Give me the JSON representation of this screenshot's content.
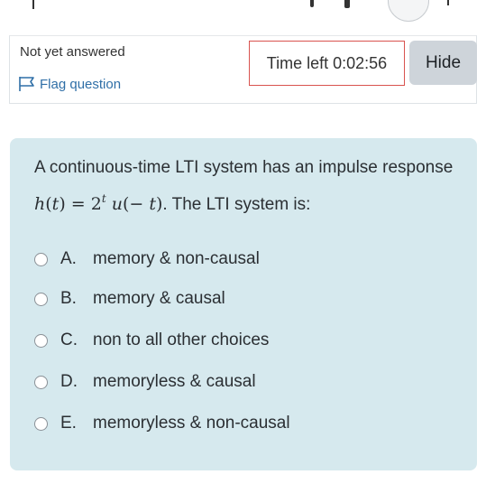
{
  "quiz_info": {
    "state": "Not yet answered",
    "flag_label": "Flag question",
    "timer": "Time left 0:02:56",
    "hide_label": "Hide"
  },
  "question": {
    "text_before": "A continuous-time LTI system has an impulse response ",
    "formula_lhs": "h",
    "formula_var": "t",
    "formula_base": "2",
    "formula_exp": "t",
    "formula_u": "u",
    "formula_arg": "− t",
    "text_after": ". The LTI system is:"
  },
  "options": [
    {
      "letter": "A.",
      "label": "memory & non-causal"
    },
    {
      "letter": "B.",
      "label": "memory & causal"
    },
    {
      "letter": "C.",
      "label": "non to all other choices"
    },
    {
      "letter": "D.",
      "label": "memoryless & causal"
    },
    {
      "letter": "E.",
      "label": "memoryless & non-causal"
    }
  ],
  "colors": {
    "question_bg": "#d6e9ee",
    "timer_border": "#d9534f",
    "link": "#2f6fa7",
    "hide_bg": "#ced4da"
  }
}
